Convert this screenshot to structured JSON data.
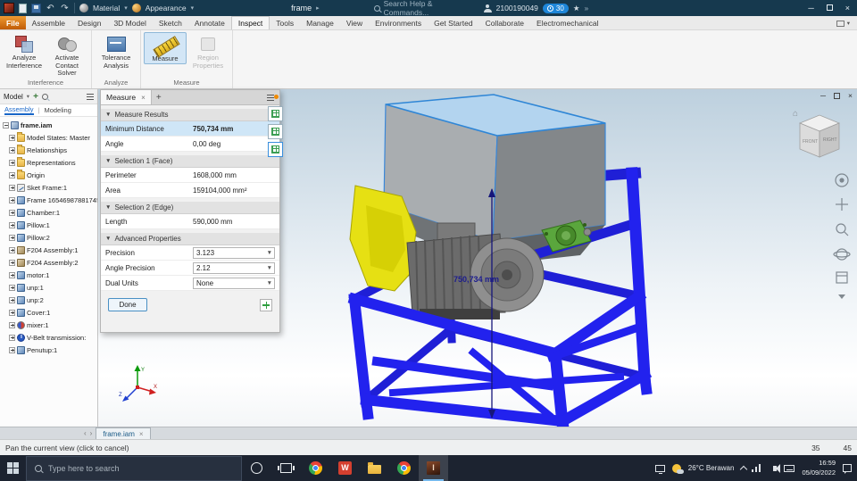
{
  "titlebar": {
    "material_label": "Material",
    "appearance_label": "Appearance",
    "filename": "frame",
    "search_placeholder": "Search Help & Commands...",
    "user_id": "2100190049",
    "badge_count": "30"
  },
  "ribbon": {
    "tabs": [
      {
        "label": "File",
        "file": true
      },
      {
        "label": "Assemble"
      },
      {
        "label": "Design"
      },
      {
        "label": "3D Model"
      },
      {
        "label": "Sketch"
      },
      {
        "label": "Annotate"
      },
      {
        "label": "Inspect",
        "active": true
      },
      {
        "label": "Tools"
      },
      {
        "label": "Manage"
      },
      {
        "label": "View"
      },
      {
        "label": "Environments"
      },
      {
        "label": "Get Started"
      },
      {
        "label": "Collaborate"
      },
      {
        "label": "Electromechanical"
      }
    ],
    "groups": [
      {
        "name": "Interference",
        "buttons": [
          {
            "label": "Analyze Interference"
          },
          {
            "label": "Activate Contact Solver"
          }
        ]
      },
      {
        "name": "Analyze",
        "buttons": [
          {
            "label": "Tolerance Analysis"
          }
        ]
      },
      {
        "name": "Measure",
        "buttons": [
          {
            "label": "Measure"
          },
          {
            "label": "Region Properties"
          }
        ]
      }
    ]
  },
  "browser": {
    "panel_label": "Model",
    "tabs": [
      {
        "label": "Assembly",
        "active": true
      },
      {
        "label": "Modeling"
      }
    ],
    "root_label": "frame.iam",
    "items": [
      {
        "label": "Model States: Master",
        "icon": "folder"
      },
      {
        "label": "Relationships",
        "icon": "folder"
      },
      {
        "label": "Representations",
        "icon": "folder"
      },
      {
        "label": "Origin",
        "icon": "folder"
      },
      {
        "label": "Sket Frame:1",
        "icon": "sketch"
      },
      {
        "label": "Frame 16546987881745...",
        "icon": "part"
      },
      {
        "label": "Chamber:1",
        "icon": "part"
      },
      {
        "label": "Pillow:1",
        "icon": "part"
      },
      {
        "label": "Pillow:2",
        "icon": "part"
      },
      {
        "label": "F204 Assembly:1",
        "icon": "assembly"
      },
      {
        "label": "F204 Assembly:2",
        "icon": "assembly"
      },
      {
        "label": "motor:1",
        "icon": "part"
      },
      {
        "label": "unp:1",
        "icon": "part"
      },
      {
        "label": "unp:2",
        "icon": "part"
      },
      {
        "label": "Cover:1",
        "icon": "part"
      },
      {
        "label": "mixer:1",
        "icon": "sync"
      },
      {
        "label": "V-Belt transmission:",
        "icon": "info"
      },
      {
        "label": "Penutup:1",
        "icon": "part"
      }
    ]
  },
  "measure": {
    "tab_label": "Measure",
    "rows": [
      {
        "type": "section",
        "label": "Measure Results"
      },
      {
        "type": "row",
        "label": "Minimum Distance",
        "value": "750,734 mm",
        "highlight": true
      },
      {
        "type": "row",
        "label": "Angle",
        "value": "0,00 deg"
      },
      {
        "type": "section",
        "label": "Selection 1 (Face)"
      },
      {
        "type": "row",
        "label": "Perimeter",
        "value": "1608,000 mm"
      },
      {
        "type": "row",
        "label": "Area",
        "value": "159104,000 mm²"
      },
      {
        "type": "section",
        "label": "Selection 2 (Edge)"
      },
      {
        "type": "row",
        "label": "Length",
        "value": "590,000 mm"
      },
      {
        "type": "section",
        "label": "Advanced Properties"
      },
      {
        "type": "dropdown",
        "label": "Precision",
        "value": "3.123"
      },
      {
        "type": "dropdown",
        "label": "Angle Precision",
        "value": "2.12"
      },
      {
        "type": "dropdown",
        "label": "Dual Units",
        "value": "None"
      }
    ],
    "done_label": "Done"
  },
  "viewport": {
    "dimension_label": "750,734 mm",
    "viewcube": {
      "front": "FRONT",
      "right": "RIGHT"
    }
  },
  "doctab": {
    "label": "frame.iam"
  },
  "statusbar": {
    "message": "Pan the current view (click to cancel)",
    "counter1": "35",
    "counter2": "45"
  },
  "taskbar": {
    "search_placeholder": "Type here to search",
    "weather": "26°C Berawan",
    "time": "16:59",
    "date": "05/09/2022"
  }
}
